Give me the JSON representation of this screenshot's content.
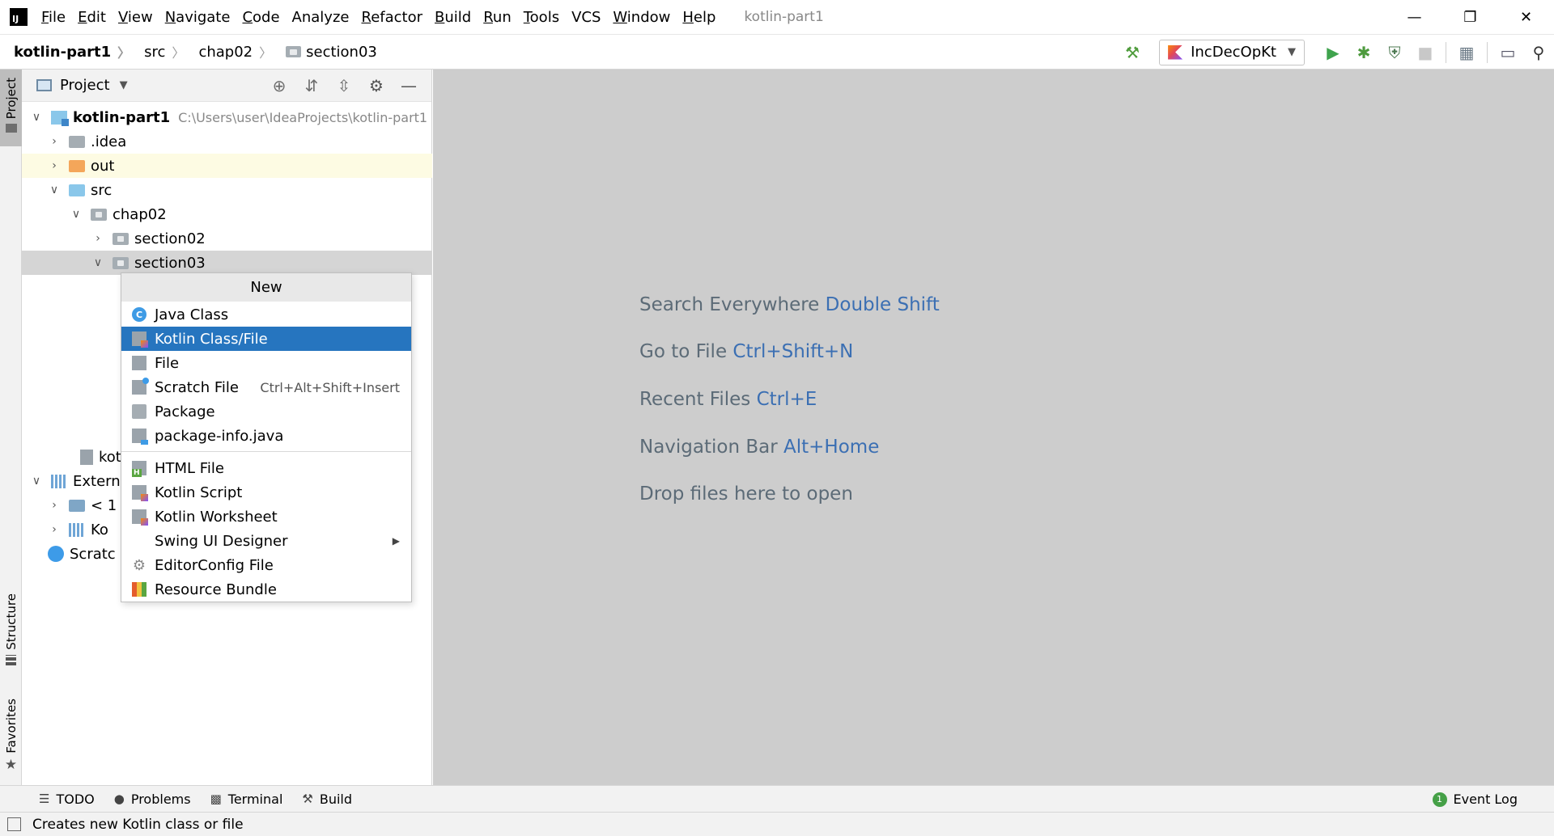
{
  "menu_bar": {
    "items": [
      {
        "label": "File",
        "mnemonic": "F",
        "rest": "ile"
      },
      {
        "label": "Edit",
        "mnemonic": "E",
        "rest": "dit"
      },
      {
        "label": "View",
        "mnemonic": "V",
        "rest": "iew"
      },
      {
        "label": "Navigate",
        "mnemonic": "N",
        "rest": "avigate"
      },
      {
        "label": "Code",
        "mnemonic": "C",
        "rest": "ode"
      },
      {
        "label": "Analyze",
        "mnemonic": "",
        "rest": "Analyze"
      },
      {
        "label": "Refactor",
        "mnemonic": "R",
        "rest": "efactor"
      },
      {
        "label": "Build",
        "mnemonic": "B",
        "rest": "uild"
      },
      {
        "label": "Run",
        "mnemonic": "R",
        "rest": "un"
      },
      {
        "label": "Tools",
        "mnemonic": "T",
        "rest": "ools"
      },
      {
        "label": "VCS",
        "mnemonic": "",
        "rest": "VCS"
      },
      {
        "label": "Window",
        "mnemonic": "W",
        "rest": "indow"
      },
      {
        "label": "Help",
        "mnemonic": "H",
        "rest": "elp"
      }
    ],
    "window_title": "kotlin-part1"
  },
  "breadcrumb": {
    "items": [
      "kotlin-part1",
      "src",
      "chap02",
      "section03"
    ]
  },
  "toolbar": {
    "run_config": "IncDecOpKt"
  },
  "project_panel": {
    "title": "Project",
    "tree": [
      {
        "label": "kotlin-part1",
        "hint": "C:\\Users\\user\\IdeaProjects\\kotlin-part1"
      },
      {
        "label": ".idea"
      },
      {
        "label": "out"
      },
      {
        "label": "src"
      },
      {
        "label": "chap02"
      },
      {
        "label": "section02"
      },
      {
        "label": "section03"
      },
      {
        "label": "kot"
      },
      {
        "label": "Extern"
      },
      {
        "label": "< 1"
      },
      {
        "label": "Ko"
      },
      {
        "label": "Scratc"
      }
    ]
  },
  "context_menu": {
    "title": "New",
    "items": [
      {
        "label": "Java Class",
        "icon_letter": "C"
      },
      {
        "label": "Kotlin Class/File"
      },
      {
        "label": "File"
      },
      {
        "label": "Scratch File",
        "shortcut": "Ctrl+Alt+Shift+Insert"
      },
      {
        "label": "Package"
      },
      {
        "label": "package-info.java"
      },
      {
        "label": "HTML File"
      },
      {
        "label": "Kotlin Script"
      },
      {
        "label": "Kotlin Worksheet"
      },
      {
        "label": "Swing UI Designer"
      },
      {
        "label": "EditorConfig File"
      },
      {
        "label": "Resource Bundle"
      }
    ],
    "highlighted_index": 1
  },
  "editor": {
    "hints": [
      {
        "text": "Search Everywhere",
        "key": "Double Shift"
      },
      {
        "text": "Go to File",
        "key": "Ctrl+Shift+N"
      },
      {
        "text": "Recent Files",
        "key": "Ctrl+E"
      },
      {
        "text": "Navigation Bar",
        "key": "Alt+Home"
      },
      {
        "text": "Drop files here to open",
        "key": ""
      }
    ]
  },
  "left_strip": {
    "project": "Project",
    "structure": "Structure",
    "favorites": "Favorites"
  },
  "bottom_bar": {
    "todo": "TODO",
    "problems": "Problems",
    "terminal": "Terminal",
    "build": "Build",
    "event_log": "Event Log",
    "event_count": "1"
  },
  "status_bar": {
    "text": "Creates new Kotlin class or file"
  },
  "colors": {
    "accent": "#2675bf",
    "editor_bg": "#cdcdcd",
    "hint_key": "#3b6fb3"
  }
}
